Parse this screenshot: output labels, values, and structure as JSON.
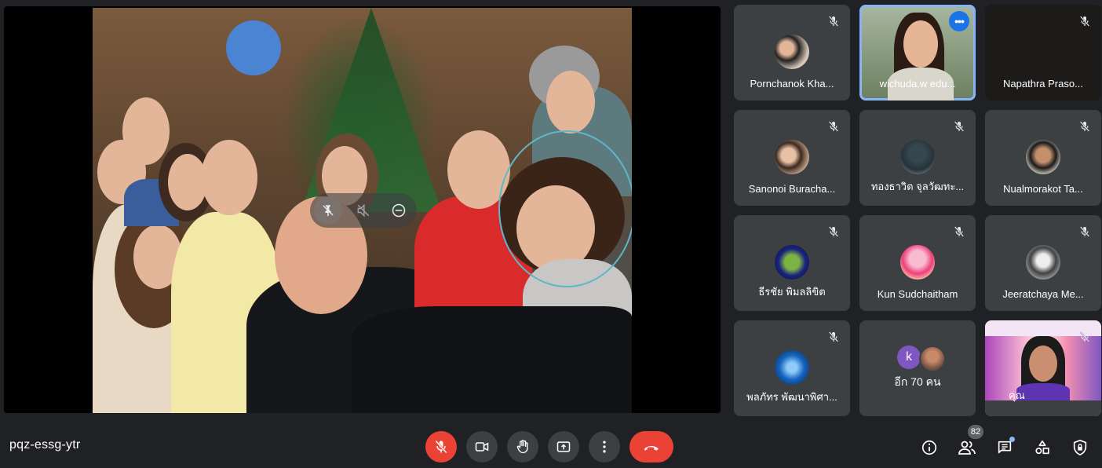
{
  "meeting": {
    "code": "pqz-essg-ytr"
  },
  "main_video": {
    "presenter_controls": [
      "pin-icon",
      "volume-off-icon",
      "remove-icon"
    ]
  },
  "participants": [
    {
      "name": "Pornchanok Kha...",
      "muted": true,
      "avatar_color": "#8d6e63"
    },
    {
      "name": "wichuda.w edu...",
      "muted": false,
      "active": true,
      "video": true
    },
    {
      "name": "Napathra Praso...",
      "muted": true,
      "video": true
    },
    {
      "name": "Sanonoi Buracha...",
      "muted": true,
      "avatar_color": "#a1887f"
    },
    {
      "name": "ทองธาวิต จุลวัฒทะ...",
      "muted": true,
      "avatar_color": "#455a64"
    },
    {
      "name": "Nualmorakot Ta...",
      "muted": true,
      "avatar_color": "#6d4c41"
    },
    {
      "name": "ธีรชัย พิมลลิขิต",
      "muted": true,
      "avatar_color": "#1a237e"
    },
    {
      "name": "Kun Sudchaitham",
      "muted": true,
      "avatar_color": "#f48fb1"
    },
    {
      "name": "Jeeratchaya Me...",
      "muted": true,
      "avatar_color": "#9e9e9e"
    },
    {
      "name": "พลภัทร พัฒนาพิศา...",
      "muted": true,
      "avatar_color": "#1565c0"
    },
    {
      "name": "อีก 70 คน",
      "others": true,
      "letter": "k"
    },
    {
      "name": "คุณ",
      "muted": true,
      "video": true
    }
  ],
  "toolbar": {
    "participant_count": "82",
    "icons": [
      "mic-off-icon",
      "videocam-icon",
      "raise-hand-icon",
      "present-screen-icon",
      "more-vert-icon",
      "call-end-icon"
    ],
    "right_icons": [
      "info-icon",
      "people-icon",
      "chat-icon",
      "activities-icon",
      "host-controls-icon"
    ]
  },
  "colors": {
    "background": "#202124",
    "tile": "#3c4043",
    "end_call": "#ea4335",
    "accent": "#8ab4f8"
  }
}
